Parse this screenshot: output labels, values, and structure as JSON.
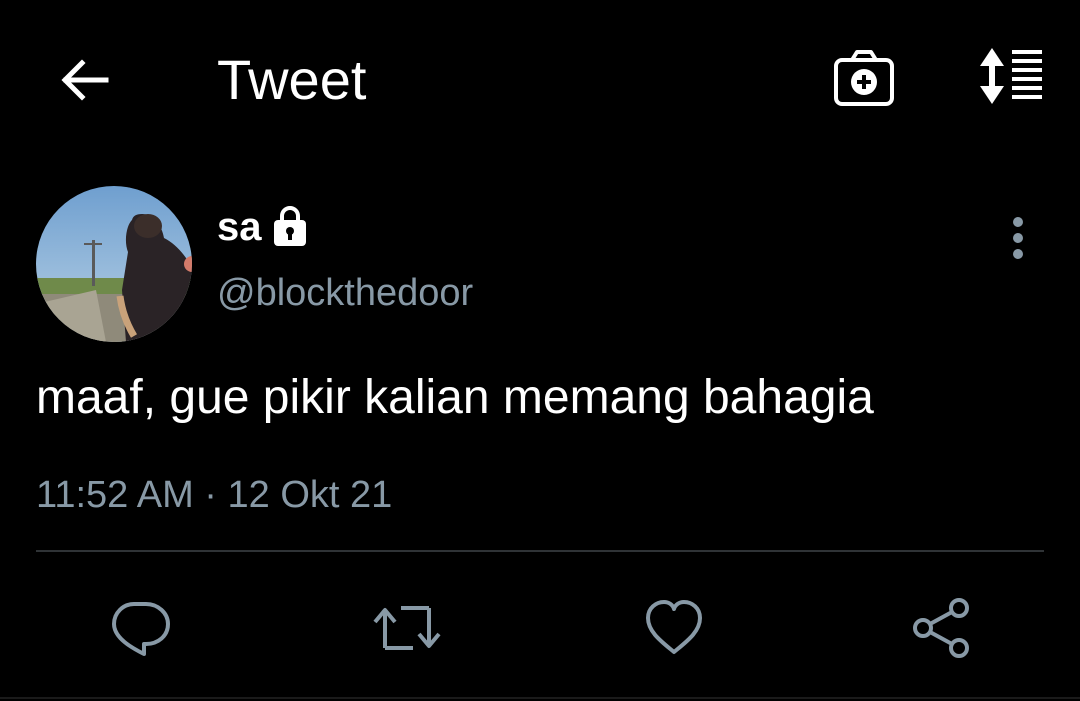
{
  "header": {
    "back_icon": "arrow-left-icon",
    "title": "Tweet",
    "camera_icon": "camera-plus-icon",
    "sort_icon": "sort-list-icon"
  },
  "tweet": {
    "author": {
      "display_name": "sa",
      "protected_icon": "lock-icon",
      "handle": "@blockthedoor",
      "avatar_icon": "avatar-photo"
    },
    "more_icon": "more-vertical-icon",
    "text": "maaf, gue pikir kalian memang bahagia",
    "timestamp": "11:52 AM · 12 Okt 21"
  },
  "actions": [
    {
      "icon": "reply-icon"
    },
    {
      "icon": "retweet-icon"
    },
    {
      "icon": "like-icon"
    },
    {
      "icon": "share-icon"
    }
  ],
  "colors": {
    "background": "#000000",
    "primary_text": "#ffffff",
    "secondary_text": "#8899a6",
    "divider": "#2f3336"
  }
}
